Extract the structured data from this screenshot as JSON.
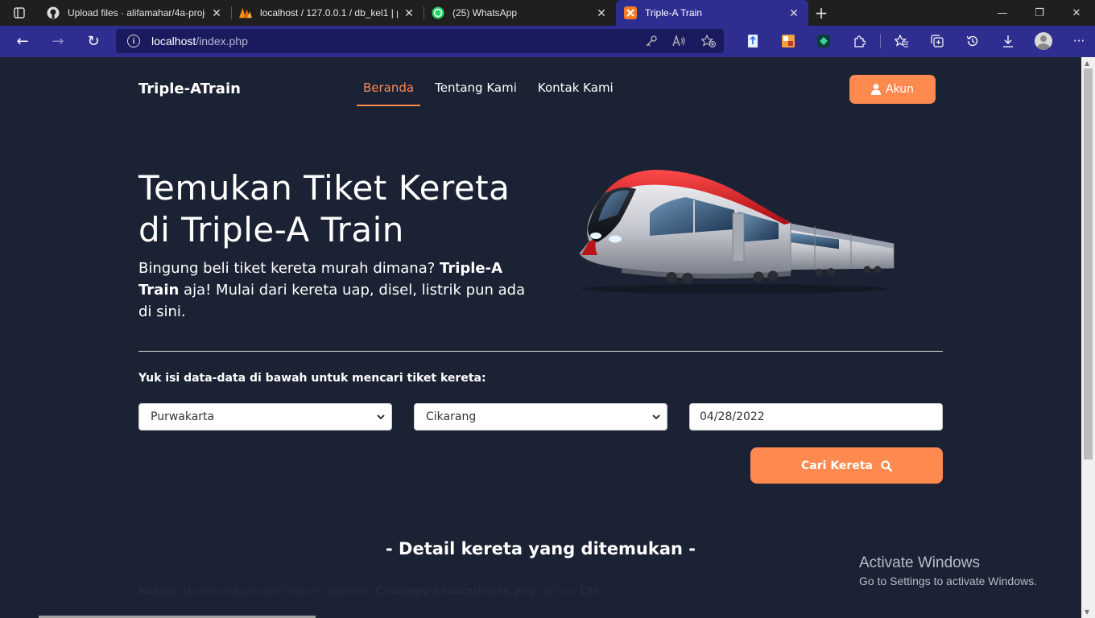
{
  "browser": {
    "tabs": [
      {
        "title": "Upload files · alifamahar/4a-proje",
        "icon": "github-icon",
        "active": false
      },
      {
        "title": "localhost / 127.0.0.1 / db_kel1 | p",
        "icon": "phpmyadmin-icon",
        "active": false
      },
      {
        "title": "(25) WhatsApp",
        "icon": "whatsapp-icon",
        "active": false
      },
      {
        "title": "Triple-A Train",
        "icon": "xampp-icon",
        "active": true
      }
    ],
    "tab_close": "✕",
    "new_tab": "+",
    "window_controls": {
      "minimize": "—",
      "maximize": "❐",
      "close": "✕"
    },
    "address": {
      "host": "localhost",
      "path": "/index.php"
    },
    "nav": {
      "back": "←",
      "forward": "→",
      "refresh": "↻"
    },
    "toolbar_more": "···"
  },
  "page": {
    "brand": "Triple-ATrain",
    "nav": [
      {
        "label": "Beranda",
        "active": true
      },
      {
        "label": "Tentang Kami",
        "active": false
      },
      {
        "label": "Kontak Kami",
        "active": false
      }
    ],
    "account_button": "Akun",
    "hero": {
      "title_line1": "Temukan Tiket Kereta",
      "title_line2": "di Triple-A Train",
      "desc_pre": "Bingung beli tiket kereta murah dimana? ",
      "desc_bold": "Triple-A Train",
      "desc_post": " aja! Mulai dari kereta uap, disel, listrik pun ada di sini."
    },
    "form": {
      "label": "Yuk isi data-data di bawah untuk mencari tiket kereta:",
      "origin": "Purwakarta",
      "destination": "Cikarang",
      "date": "04/28/2022",
      "submit": "Cari Kereta"
    },
    "results_title": "- Detail kereta yang ditemukan -",
    "notice": {
      "label": "Notice",
      "message": ": Undefined variable: tickets_result in ",
      "path": "C:\\xampp\\htdocs\\index.php",
      "line_text": " on line ",
      "line": "125"
    }
  },
  "os_watermark": {
    "line1": "Activate Windows",
    "line2": "Go to Settings to activate Windows."
  },
  "colors": {
    "accent": "#ff8a50",
    "page_bg": "#1b2233",
    "browser_bar": "#2e2e91"
  }
}
